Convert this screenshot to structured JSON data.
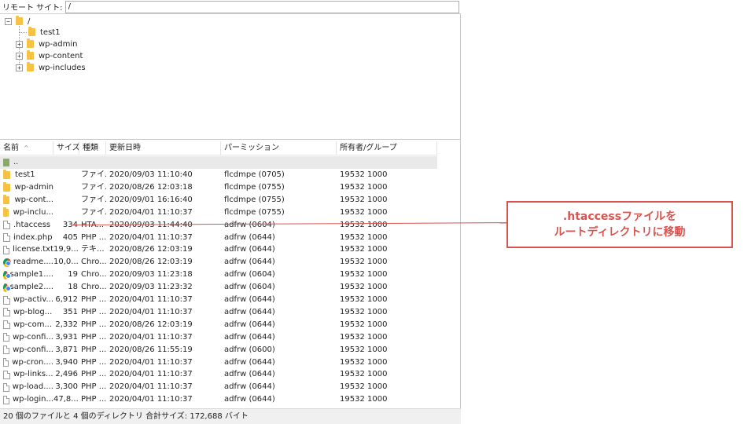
{
  "site_bar": {
    "label": "リモート サイト:",
    "path_value": "/"
  },
  "tree": {
    "root": {
      "label": "/"
    },
    "items": [
      {
        "label": "test1",
        "expandable": false
      },
      {
        "label": "wp-admin",
        "expandable": true
      },
      {
        "label": "wp-content",
        "expandable": true
      },
      {
        "label": "wp-includes",
        "expandable": true
      }
    ]
  },
  "list": {
    "headers": {
      "name": "名前",
      "size": "サイズ",
      "type": "種類",
      "date": "更新日時",
      "perm": "パーミッション",
      "owner": "所有者/グループ"
    },
    "parent_label": "..",
    "rows": [
      {
        "icon": "folder",
        "name": "test1",
        "size": "",
        "type": "ファイ...",
        "date": "2020/09/03 11:10:40",
        "perm": "flcdmpe (0705)",
        "owner": "19532 1000"
      },
      {
        "icon": "folder",
        "name": "wp-admin",
        "size": "",
        "type": "ファイ...",
        "date": "2020/08/26 12:03:18",
        "perm": "flcdmpe (0755)",
        "owner": "19532 1000"
      },
      {
        "icon": "folder",
        "name": "wp-cont...",
        "size": "",
        "type": "ファイ...",
        "date": "2020/09/01 16:16:40",
        "perm": "flcdmpe (0755)",
        "owner": "19532 1000"
      },
      {
        "icon": "folder",
        "name": "wp-inclu...",
        "size": "",
        "type": "ファイ...",
        "date": "2020/04/01 11:10:37",
        "perm": "flcdmpe (0755)",
        "owner": "19532 1000"
      },
      {
        "icon": "file",
        "name": ".htaccess",
        "size": "334",
        "type": "HTA...",
        "date": "2020/09/03 11:44:40",
        "perm": "adfrw (0604)",
        "owner": "19532 1000"
      },
      {
        "icon": "file",
        "name": "index.php",
        "size": "405",
        "type": "PHP ...",
        "date": "2020/04/01 11:10:37",
        "perm": "adfrw (0644)",
        "owner": "19532 1000"
      },
      {
        "icon": "file",
        "name": "license.txt",
        "size": "19,9...",
        "type": "テキ...",
        "date": "2020/08/26 12:03:19",
        "perm": "adfrw (0644)",
        "owner": "19532 1000"
      },
      {
        "icon": "chrome",
        "name": "readme....",
        "size": "10,0...",
        "type": "Chro...",
        "date": "2020/08/26 12:03:19",
        "perm": "adfrw (0644)",
        "owner": "19532 1000"
      },
      {
        "icon": "chrome",
        "name": "sample1....",
        "size": "19",
        "type": "Chro...",
        "date": "2020/09/03 11:23:18",
        "perm": "adfrw (0604)",
        "owner": "19532 1000"
      },
      {
        "icon": "chrome",
        "name": "sample2....",
        "size": "18",
        "type": "Chro...",
        "date": "2020/09/03 11:23:32",
        "perm": "adfrw (0604)",
        "owner": "19532 1000"
      },
      {
        "icon": "file",
        "name": "wp-activ...",
        "size": "6,912",
        "type": "PHP ...",
        "date": "2020/04/01 11:10:37",
        "perm": "adfrw (0644)",
        "owner": "19532 1000"
      },
      {
        "icon": "file",
        "name": "wp-blog...",
        "size": "351",
        "type": "PHP ...",
        "date": "2020/04/01 11:10:37",
        "perm": "adfrw (0644)",
        "owner": "19532 1000"
      },
      {
        "icon": "file",
        "name": "wp-com...",
        "size": "2,332",
        "type": "PHP ...",
        "date": "2020/08/26 12:03:19",
        "perm": "adfrw (0644)",
        "owner": "19532 1000"
      },
      {
        "icon": "file",
        "name": "wp-confi...",
        "size": "3,931",
        "type": "PHP ...",
        "date": "2020/04/01 11:10:37",
        "perm": "adfrw (0644)",
        "owner": "19532 1000"
      },
      {
        "icon": "file",
        "name": "wp-confi...",
        "size": "3,871",
        "type": "PHP ...",
        "date": "2020/08/26 11:55:19",
        "perm": "adfrw (0600)",
        "owner": "19532 1000"
      },
      {
        "icon": "file",
        "name": "wp-cron....",
        "size": "3,940",
        "type": "PHP ...",
        "date": "2020/04/01 11:10:37",
        "perm": "adfrw (0644)",
        "owner": "19532 1000"
      },
      {
        "icon": "file",
        "name": "wp-links...",
        "size": "2,496",
        "type": "PHP ...",
        "date": "2020/04/01 11:10:37",
        "perm": "adfrw (0644)",
        "owner": "19532 1000"
      },
      {
        "icon": "file",
        "name": "wp-load....",
        "size": "3,300",
        "type": "PHP ...",
        "date": "2020/04/01 11:10:37",
        "perm": "adfrw (0644)",
        "owner": "19532 1000"
      },
      {
        "icon": "file",
        "name": "wp-login...",
        "size": "47,8...",
        "type": "PHP ...",
        "date": "2020/04/01 11:10:37",
        "perm": "adfrw (0644)",
        "owner": "19532 1000"
      }
    ]
  },
  "status": {
    "text": "20 個のファイルと 4 個のディレクトリ 合計サイズ: 172,688 バイト"
  },
  "callout": {
    "line1": ".htaccessファイルを",
    "line2": "ルートディレクトリに移動"
  },
  "colors": {
    "accent": "#d9534f",
    "folder": "#f5c242"
  }
}
